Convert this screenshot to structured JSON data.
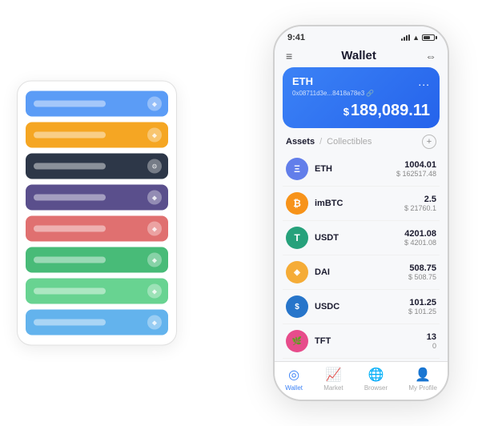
{
  "scene": {
    "background": "#ffffff"
  },
  "cardStack": {
    "rows": [
      {
        "color": "row-blue",
        "icon": "◆"
      },
      {
        "color": "row-orange",
        "icon": "◆"
      },
      {
        "color": "row-dark",
        "icon": "⚙"
      },
      {
        "color": "row-purple",
        "icon": "◆"
      },
      {
        "color": "row-red",
        "icon": "◆"
      },
      {
        "color": "row-green",
        "icon": "◆"
      },
      {
        "color": "row-lightgreen",
        "icon": "◆"
      },
      {
        "color": "row-lightblue",
        "icon": "◆"
      }
    ]
  },
  "phone": {
    "statusBar": {
      "time": "9:41"
    },
    "header": {
      "title": "Wallet",
      "menuIcon": "≡",
      "expandIcon": "⇔"
    },
    "ethCard": {
      "coin": "ETH",
      "address": "0x08711d3e...8418a78e3",
      "addressSuffix": "🔗",
      "moreIcon": "...",
      "dollarSign": "$",
      "amount": "189,089.11"
    },
    "assetsSection": {
      "activeTab": "Assets",
      "separator": "/",
      "inactiveTab": "Collectibles",
      "addIcon": "+"
    },
    "assets": [
      {
        "symbol": "ETH",
        "iconLabel": "Ξ",
        "iconClass": "asset-icon-eth",
        "amount": "1004.01",
        "usd": "$ 162517.48"
      },
      {
        "symbol": "imBTC",
        "iconLabel": "₿",
        "iconClass": "asset-icon-imbtc",
        "amount": "2.5",
        "usd": "$ 21760.1"
      },
      {
        "symbol": "USDT",
        "iconLabel": "T",
        "iconClass": "asset-icon-usdt",
        "amount": "4201.08",
        "usd": "$ 4201.08"
      },
      {
        "symbol": "DAI",
        "iconLabel": "◈",
        "iconClass": "asset-icon-dai",
        "amount": "508.75",
        "usd": "$ 508.75"
      },
      {
        "symbol": "USDC",
        "iconLabel": "$",
        "iconClass": "asset-icon-usdc",
        "amount": "101.25",
        "usd": "$ 101.25"
      },
      {
        "symbol": "TFT",
        "iconLabel": "🌿",
        "iconClass": "asset-icon-tft",
        "amount": "13",
        "usd": "0"
      }
    ],
    "nav": [
      {
        "label": "Wallet",
        "icon": "◎",
        "active": true
      },
      {
        "label": "Market",
        "icon": "📊",
        "active": false
      },
      {
        "label": "Browser",
        "icon": "🌐",
        "active": false
      },
      {
        "label": "My Profile",
        "icon": "👤",
        "active": false
      }
    ]
  }
}
